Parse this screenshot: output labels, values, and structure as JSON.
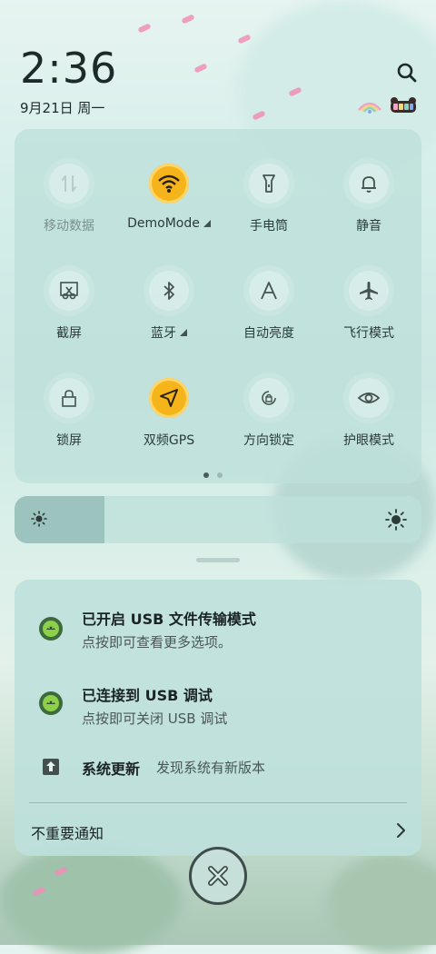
{
  "status": {
    "time": "2:36",
    "date": "9月21日 周一"
  },
  "quick_settings": {
    "tiles": [
      {
        "label": "移动数据",
        "icon": "mobile-data-icon",
        "active": false
      },
      {
        "label": "DemoMode",
        "icon": "wifi-icon",
        "active": true,
        "expandable": true
      },
      {
        "label": "手电筒",
        "icon": "flashlight-icon",
        "active": false
      },
      {
        "label": "静音",
        "icon": "bell-icon",
        "active": false
      },
      {
        "label": "截屏",
        "icon": "screenshot-icon",
        "active": false
      },
      {
        "label": "蓝牙",
        "icon": "bluetooth-icon",
        "active": false,
        "expandable": true
      },
      {
        "label": "自动亮度",
        "icon": "auto-brightness-icon",
        "active": false
      },
      {
        "label": "飞行模式",
        "icon": "airplane-icon",
        "active": false
      },
      {
        "label": "锁屏",
        "icon": "lock-icon",
        "active": false
      },
      {
        "label": "双频GPS",
        "icon": "gps-icon",
        "active": true
      },
      {
        "label": "方向锁定",
        "icon": "rotation-lock-icon",
        "active": false
      },
      {
        "label": "护眼模式",
        "icon": "eye-icon",
        "active": false
      }
    ],
    "page_count": 2,
    "current_page": 1
  },
  "brightness": {
    "level": 0.22
  },
  "notifications": [
    {
      "title": "已开启 USB 文件传输模式",
      "body": "点按即可查看更多选项。",
      "icon": "android-usb-icon"
    },
    {
      "title": "已连接到 USB 调试",
      "body": "点按即可关闭 USB 调试",
      "icon": "android-usb-icon"
    },
    {
      "title": "系统更新",
      "body": "发现系统有新版本",
      "icon": "system-update-icon"
    }
  ],
  "unimportant_label": "不重要通知",
  "colors": {
    "accent_on": "#f6b41b",
    "panel": "#bee0db"
  }
}
